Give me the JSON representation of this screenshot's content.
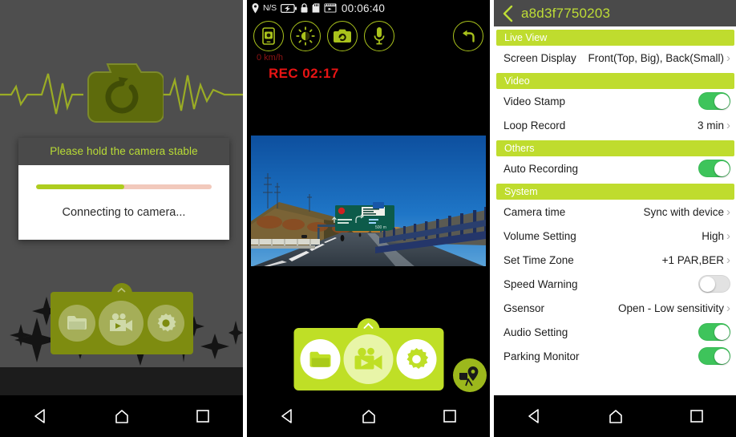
{
  "panel1": {
    "name": "connecting-screen",
    "dialog": {
      "title": "Please hold the camera stable",
      "message": "Connecting to camera...",
      "progress_percent": 50
    },
    "logo_icon": "camera-refresh-icon",
    "toolbar": [
      {
        "icon": "folder-icon",
        "label": "Files"
      },
      {
        "icon": "video-camera-icon",
        "label": "Live View"
      },
      {
        "icon": "gear-icon",
        "label": "Settings"
      }
    ],
    "colors": {
      "accent": "#aecd1f",
      "background": "#4e4e4e",
      "title_bar": "#4a4a4a"
    }
  },
  "panel2": {
    "name": "live-view-screen",
    "statusbar": {
      "gps_label": "N/S",
      "gps_icon": "location-pin-icon",
      "battery_icon": "battery-charging-icon",
      "lock_icon": "padlock-icon",
      "sdcard_icon": "sd-card-icon",
      "video_icon": "film-video-icon",
      "time": "00:06:40"
    },
    "controls": [
      {
        "icon": "phone-snapshot-icon",
        "label": "Save to phone"
      },
      {
        "icon": "brightness-icon",
        "label": "Brightness"
      },
      {
        "icon": "camera-switch-icon",
        "label": "Switch camera"
      },
      {
        "icon": "microphone-icon",
        "label": "Microphone"
      }
    ],
    "back_button": {
      "icon": "back-arrow-icon",
      "label": "Back"
    },
    "overlay": {
      "speed": "0 km/h",
      "recording": "REC 02:17"
    },
    "toolbar": [
      {
        "icon": "folder-icon",
        "label": "Files"
      },
      {
        "icon": "video-camera-icon",
        "label": "Live View"
      },
      {
        "icon": "gear-icon",
        "label": "Settings"
      }
    ],
    "map_button": {
      "icon": "map-pin-icon",
      "label": "Map"
    },
    "colors": {
      "accent": "#bfdf26",
      "rec": "#e81414",
      "speed": "#8f1414"
    }
  },
  "panel3": {
    "name": "settings-screen",
    "header": {
      "back_icon": "chevron-left-icon",
      "title": "a8d3f7750203"
    },
    "sections": [
      {
        "title": "Live View",
        "rows": [
          {
            "label": "Screen Display",
            "type": "value",
            "value": "Front(Top, Big), Back(Small)"
          }
        ]
      },
      {
        "title": "Video",
        "rows": [
          {
            "label": "Video Stamp",
            "type": "toggle",
            "value": "on"
          },
          {
            "label": "Loop Record",
            "type": "value",
            "value": "3 min"
          }
        ]
      },
      {
        "title": "Others",
        "rows": [
          {
            "label": "Auto Recording",
            "type": "toggle",
            "value": "on"
          }
        ]
      },
      {
        "title": "System",
        "rows": [
          {
            "label": "Camera time",
            "type": "value",
            "value": "Sync with device"
          },
          {
            "label": "Volume Setting",
            "type": "value",
            "value": "High"
          },
          {
            "label": "Set Time Zone",
            "type": "value",
            "value": "+1 PAR,BER"
          },
          {
            "label": "Speed Warning",
            "type": "toggle",
            "value": "off"
          },
          {
            "label": "Gsensor",
            "type": "value",
            "value": "Open - Low sensitivity"
          },
          {
            "label": "Audio Setting",
            "type": "toggle",
            "value": "on"
          },
          {
            "label": "Parking Monitor",
            "type": "toggle",
            "value": "on"
          }
        ]
      }
    ],
    "colors": {
      "section_header": "#bfdc2e",
      "toggle_on": "#3ec45b",
      "toggle_off": "#e2e2e2",
      "header_bg": "#4a4a4a",
      "title": "#bedd36"
    }
  },
  "navbar": {
    "back": "back-triangle-icon",
    "home": "home-icon",
    "recents": "recents-square-icon"
  }
}
